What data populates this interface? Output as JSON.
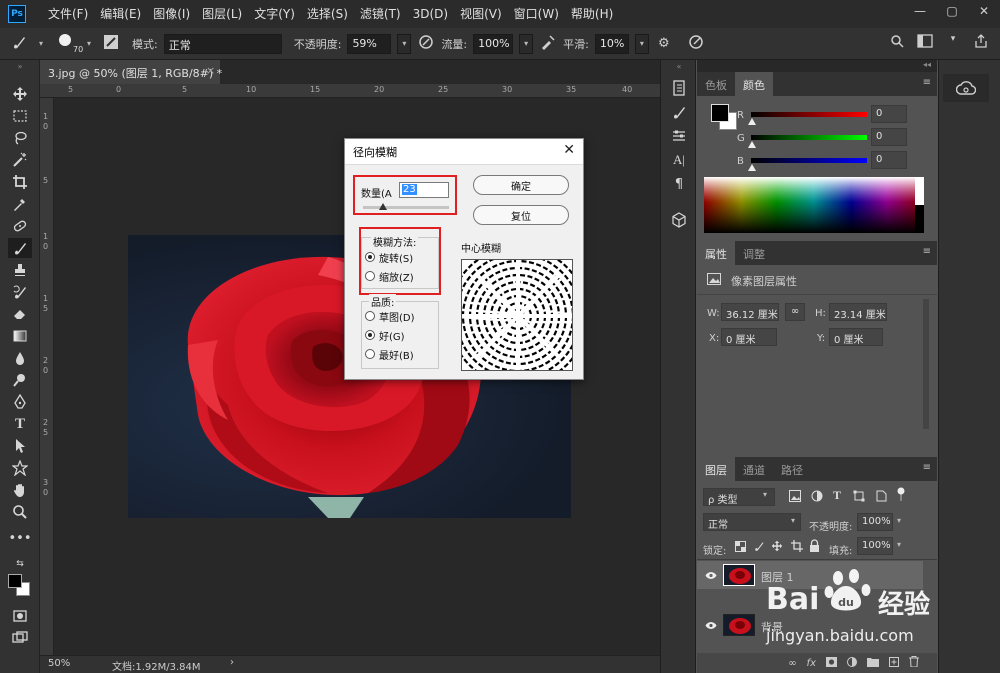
{
  "menubar": {
    "logo": "Ps",
    "items": [
      "文件(F)",
      "编辑(E)",
      "图像(I)",
      "图层(L)",
      "文字(Y)",
      "选择(S)",
      "滤镜(T)",
      "3D(D)",
      "视图(V)",
      "窗口(W)",
      "帮助(H)"
    ],
    "minimize": "—",
    "restore": "▢",
    "close": "✕"
  },
  "options": {
    "brush_size": "70",
    "mode_label": "模式:",
    "mode_value": "正常",
    "opacity_label": "不透明度:",
    "opacity_value": "59%",
    "flow_label": "流量:",
    "flow_value": "100%",
    "smooth_label": "平滑:",
    "smooth_value": "10%"
  },
  "document": {
    "tab_title": "3.jpg @ 50% (图层 1, RGB/8#) *",
    "tab_close": "×",
    "ruler_top_ticks": [
      "5",
      "0",
      "5",
      "10",
      "15",
      "20",
      "25",
      "30",
      "35",
      "40"
    ],
    "ruler_left_ticks": [
      "1",
      "0",
      "5",
      "1",
      "0",
      "1",
      "5",
      "2",
      "0",
      "2",
      "5",
      "3",
      "0"
    ],
    "zoom": "50%",
    "doc_size": "文档:1.92M/3.84M",
    "status_arrow": "›"
  },
  "dialog": {
    "title": "径向模糊",
    "close": "✕",
    "amount_label": "数量(A",
    "amount_value": "23",
    "ok": "确定",
    "reset": "复位",
    "method_label": "模糊方法:",
    "method_spin": "旋转(S)",
    "method_zoom": "缩放(Z)",
    "center_label": "中心模糊",
    "quality_label": "品质:",
    "quality_draft": "草图(D)",
    "quality_good": "好(G)",
    "quality_best": "最好(B)",
    "amount_fraction": 0.23
  },
  "color_panel": {
    "tabs": [
      "色板",
      "颜色"
    ],
    "menu": "≡",
    "r_label": "R",
    "g_label": "G",
    "b_label": "B",
    "r_value": "0",
    "g_value": "0",
    "b_value": "0",
    "collapse": "◂◂"
  },
  "properties_panel": {
    "tabs": [
      "属性",
      "调整"
    ],
    "menu": "≡",
    "title": "像素图层属性",
    "w_label": "W:",
    "w_value": "36.12 厘米",
    "h_label": "H:",
    "h_value": "23.14 厘米",
    "x_label": "X:",
    "x_value": "0 厘米",
    "y_label": "Y:",
    "y_value": "0 厘米",
    "link": "∞"
  },
  "layers_panel": {
    "tabs": [
      "图层",
      "通道",
      "路径"
    ],
    "menu": "≡",
    "filter_value": "ρ 类型",
    "blend_value": "正常",
    "opacity_label": "不透明度:",
    "opacity_value": "100%",
    "lock_label": "锁定:",
    "fill_label": "填充:",
    "fill_value": "100%",
    "layers": [
      {
        "name": "图层 1",
        "selected": true
      },
      {
        "name": "背景",
        "selected": false
      }
    ],
    "bottom_icons": [
      "∞",
      "fx"
    ]
  },
  "watermark": {
    "brand": "Bai",
    "brand2": "du",
    "cn": "经验",
    "url": "jingyan.baidu.com"
  }
}
